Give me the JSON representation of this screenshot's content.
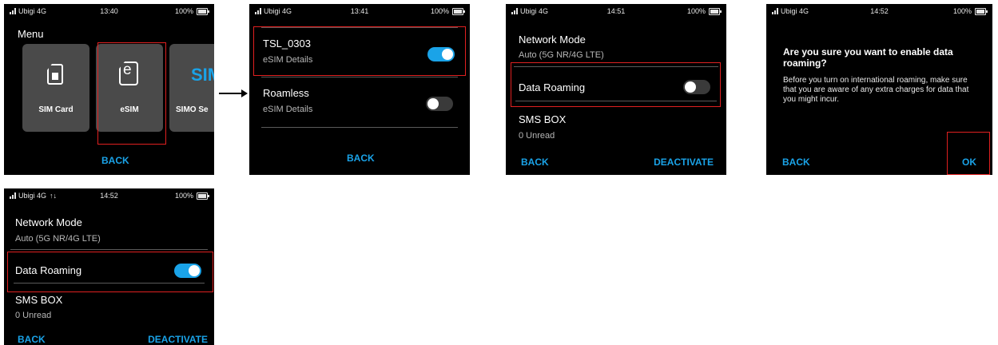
{
  "colors": {
    "accent": "#1aa3e8",
    "highlight": "#e02020",
    "background": "#000000"
  },
  "screens": [
    {
      "status": {
        "carrier": "Ubigi 4G",
        "time": "13:40",
        "battery": "100%"
      },
      "header": "Menu",
      "tiles": [
        {
          "label": "SIM Card",
          "icon": "sim-card-icon"
        },
        {
          "label": "eSIM",
          "icon": "esim-icon"
        },
        {
          "label": "SIMO Se",
          "icon_text": "SIM",
          "icon": "simo-icon"
        }
      ],
      "softkey": "BACK"
    },
    {
      "status": {
        "carrier": "Ubigi 4G",
        "time": "13:41",
        "battery": "100%"
      },
      "items": [
        {
          "title": "TSL_0303",
          "subtitle": "eSIM Details",
          "toggle": "on"
        },
        {
          "title": "Roamless",
          "subtitle": "eSIM Details",
          "toggle": "off"
        }
      ],
      "softkey": "BACK"
    },
    {
      "status": {
        "carrier": "Ubigi 4G",
        "time": "14:51",
        "battery": "100%"
      },
      "network_mode": {
        "title": "Network Mode",
        "value": "Auto (5G NR/4G LTE)"
      },
      "data_roaming": {
        "title": "Data Roaming",
        "toggle": "off"
      },
      "sms_box": {
        "title": "SMS BOX",
        "value": "0 Unread"
      },
      "softkey_left": "BACK",
      "softkey_right": "DEACTIVATE"
    },
    {
      "status": {
        "carrier": "Ubigi 4G",
        "time": "14:52",
        "battery": "100%"
      },
      "dialog_title": "Are you sure you want to enable data roaming?",
      "dialog_body": "Before you turn on international roaming, make sure that you are aware of any extra charges for data that you might incur.",
      "softkey_left": "BACK",
      "softkey_right": "OK"
    },
    {
      "status": {
        "carrier": "Ubigi 4G",
        "time": "14:52",
        "battery": "100%",
        "data_indicator": "↑↓"
      },
      "network_mode": {
        "title": "Network Mode",
        "value": "Auto (5G NR/4G LTE)"
      },
      "data_roaming": {
        "title": "Data Roaming",
        "toggle": "on"
      },
      "sms_box": {
        "title": "SMS BOX",
        "value": "0 Unread"
      },
      "softkey_left": "BACK",
      "softkey_right": "DEACTIVATE"
    }
  ]
}
